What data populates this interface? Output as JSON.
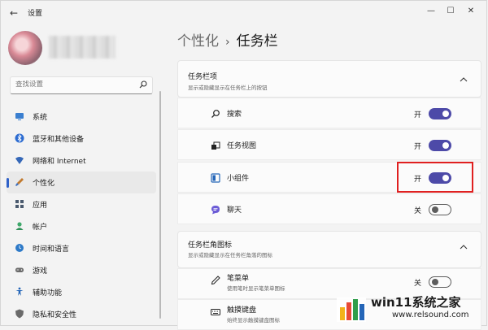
{
  "window": {
    "title": "设置",
    "back_glyph": "←",
    "minimize_glyph": "—",
    "maximize_glyph": "☐",
    "close_glyph": "✕"
  },
  "search": {
    "placeholder": "查找设置",
    "icon": "search-icon"
  },
  "sidebar": {
    "items": [
      {
        "label": "系统",
        "icon": "monitor-icon",
        "color": "#3b7fd0"
      },
      {
        "label": "蓝牙和其他设备",
        "icon": "bluetooth-icon",
        "color": "#2d6cd1"
      },
      {
        "label": "网络和 Internet",
        "icon": "wifi-icon",
        "color": "#3568b8"
      },
      {
        "label": "个性化",
        "icon": "brush-icon",
        "color": "#c27a2e",
        "active": true
      },
      {
        "label": "应用",
        "icon": "apps-icon",
        "color": "#4a5a6e"
      },
      {
        "label": "帐户",
        "icon": "account-icon",
        "color": "#3fa86b"
      },
      {
        "label": "时间和语言",
        "icon": "globe-clock-icon",
        "color": "#2e7ac8"
      },
      {
        "label": "游戏",
        "icon": "gamepad-icon",
        "color": "#6a6a6a"
      },
      {
        "label": "辅助功能",
        "icon": "accessibility-icon",
        "color": "#2566b8"
      },
      {
        "label": "隐私和安全性",
        "icon": "shield-icon",
        "color": "#6a6a6a"
      }
    ]
  },
  "breadcrumb": {
    "parent": "个性化",
    "separator": "›",
    "current": "任务栏"
  },
  "section_taskbar_items": {
    "title": "任务栏项",
    "subtitle": "显示或隐藏显示在任务栏上的按钮",
    "rows": [
      {
        "label": "搜索",
        "icon": "search-icon",
        "state": "开",
        "on": true
      },
      {
        "label": "任务视图",
        "icon": "task-view-icon",
        "state": "开",
        "on": true
      },
      {
        "label": "小组件",
        "icon": "widgets-icon",
        "state": "开",
        "on": true
      },
      {
        "label": "聊天",
        "icon": "chat-icon",
        "state": "关",
        "on": false
      }
    ]
  },
  "section_corner_icons": {
    "title": "任务栏角图标",
    "subtitle": "显示或隐藏显示在任务栏角落的图标",
    "rows": [
      {
        "label": "笔菜单",
        "sub": "使用笔时显示笔菜单图标",
        "icon": "pen-icon",
        "state": "关",
        "on": false
      },
      {
        "label": "触摸键盘",
        "sub": "始终显示触摸键盘图标",
        "icon": "keyboard-icon"
      }
    ]
  },
  "watermark": {
    "title": "win11系统之家",
    "url": "www.relsound.com"
  },
  "colors": {
    "accent": "#4d4aa8",
    "highlight": "#e02020",
    "nav_indicator": "#2f61c8"
  }
}
